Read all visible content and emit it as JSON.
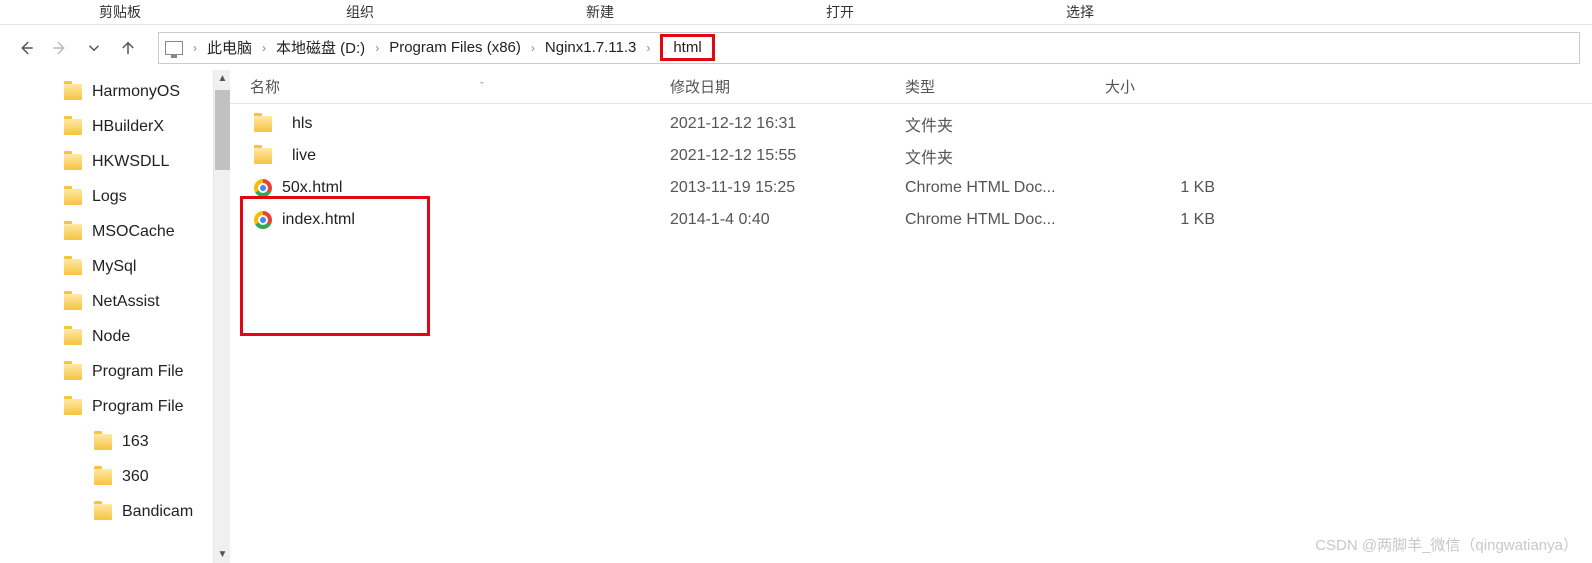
{
  "ribbon": {
    "categories": [
      "剪贴板",
      "组织",
      "新建",
      "打开",
      "选择"
    ]
  },
  "nav": {
    "back_icon": "arrow-left",
    "forward_icon": "arrow-right",
    "up_icon": "arrow-up"
  },
  "breadcrumb": {
    "items": [
      "此电脑",
      "本地磁盘 (D:)",
      "Program Files (x86)",
      "Nginx1.7.11.3",
      "html"
    ]
  },
  "sidebar": {
    "items": [
      {
        "label": "HarmonyOS",
        "indent": false
      },
      {
        "label": "HBuilderX",
        "indent": false
      },
      {
        "label": "HKWSDLL",
        "indent": false
      },
      {
        "label": "Logs",
        "indent": false
      },
      {
        "label": "MSOCache",
        "indent": false
      },
      {
        "label": "MySql",
        "indent": false
      },
      {
        "label": "NetAssist",
        "indent": false
      },
      {
        "label": "Node",
        "indent": false
      },
      {
        "label": "Program File",
        "indent": false
      },
      {
        "label": "Program File",
        "indent": false
      },
      {
        "label": "163",
        "indent": true
      },
      {
        "label": "360",
        "indent": true
      },
      {
        "label": "Bandicam",
        "indent": true
      }
    ]
  },
  "columns": {
    "name": "名称",
    "modified": "修改日期",
    "type": "类型",
    "size": "大小",
    "sort_indicator": "ˇ"
  },
  "files": [
    {
      "name": "hls",
      "modified": "2021-12-12 16:31",
      "type": "文件夹",
      "size": "",
      "icon": "folder"
    },
    {
      "name": "live",
      "modified": "2021-12-12 15:55",
      "type": "文件夹",
      "size": "",
      "icon": "folder"
    },
    {
      "name": "50x.html",
      "modified": "2013-11-19 15:25",
      "type": "Chrome HTML Doc...",
      "size": "1 KB",
      "icon": "chrome"
    },
    {
      "name": "index.html",
      "modified": "2014-1-4 0:40",
      "type": "Chrome HTML Doc...",
      "size": "1 KB",
      "icon": "chrome"
    }
  ],
  "watermark": "CSDN @两脚羊_微信（qingwatianya）"
}
